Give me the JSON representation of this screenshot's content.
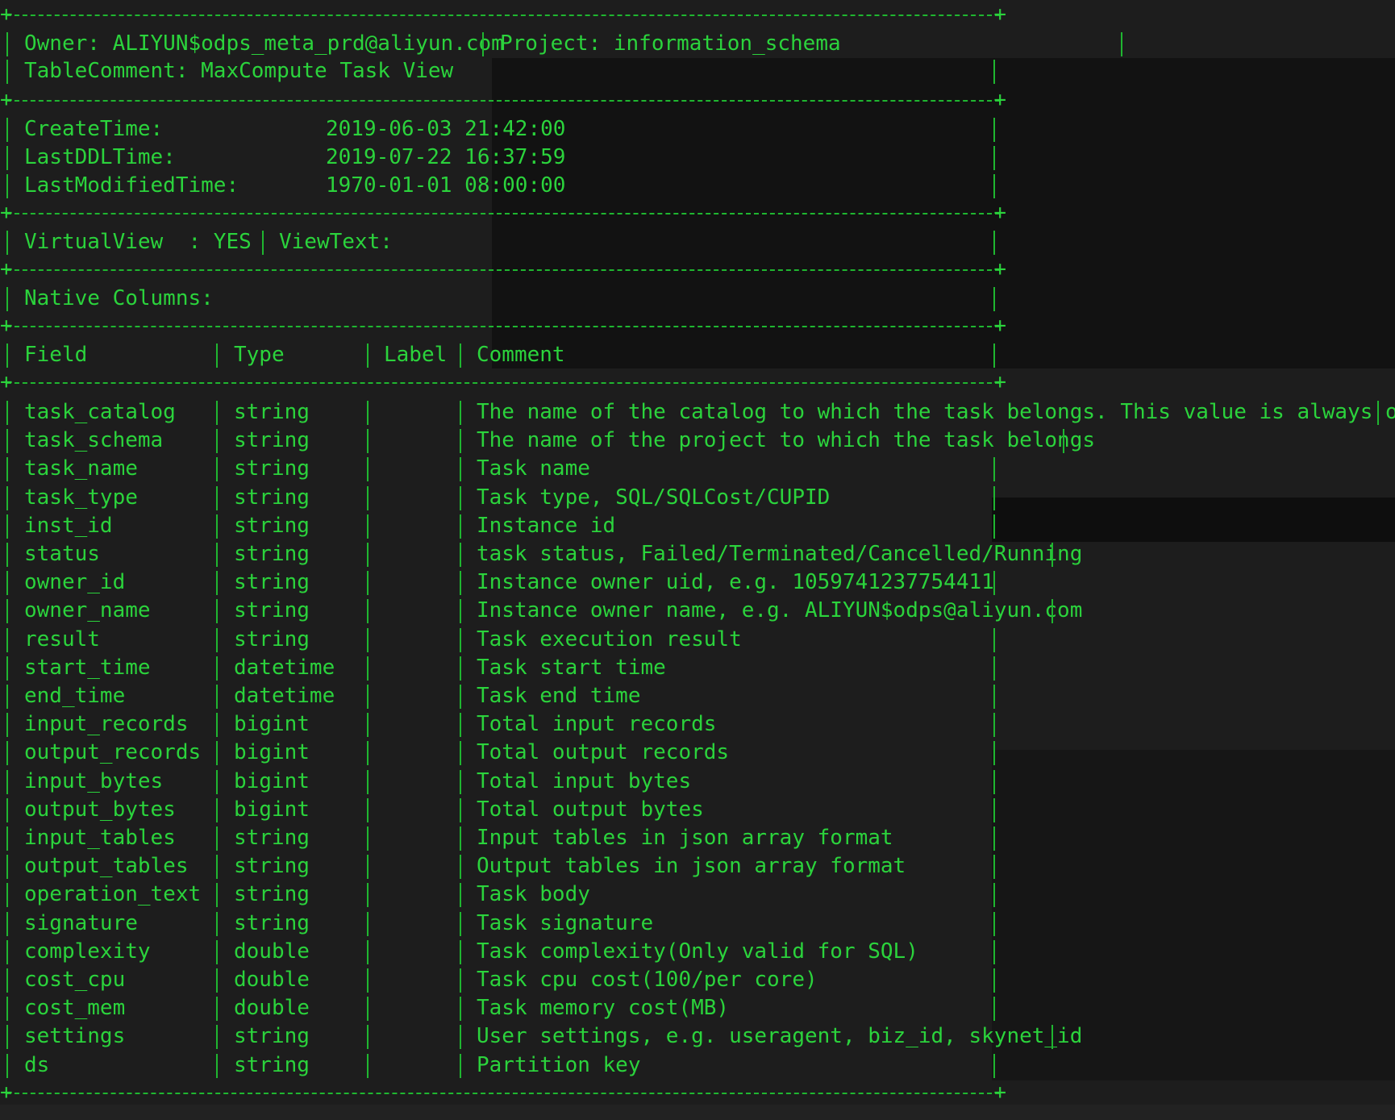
{
  "header": {
    "owner": "Owner: ALIYUN$odps_meta_prd@aliyun.com",
    "project": "Project: information_schema",
    "table_comment": "TableComment: MaxCompute Task View"
  },
  "times": [
    {
      "label": "CreateTime:",
      "value": "2019-06-03 21:42:00"
    },
    {
      "label": "LastDDLTime:",
      "value": "2019-07-22 16:37:59"
    },
    {
      "label": "LastModifiedTime:",
      "value": "1970-01-01 08:00:00"
    }
  ],
  "view": {
    "virtual_view": "VirtualView  : YES",
    "view_text": "ViewText:"
  },
  "native_columns_label": "Native Columns:",
  "columns_header": {
    "field": "Field",
    "type": "Type",
    "label": "Label",
    "comment": "Comment"
  },
  "rows": [
    {
      "field": "task_catalog",
      "type": "string",
      "label": "",
      "comment": "The name of the catalog to which the task belongs. This value is always odps"
    },
    {
      "field": "task_schema",
      "type": "string",
      "label": "",
      "comment": "The name of the project to which the task belongs"
    },
    {
      "field": "task_name",
      "type": "string",
      "label": "",
      "comment": "Task name"
    },
    {
      "field": "task_type",
      "type": "string",
      "label": "",
      "comment": "Task type, SQL/SQLCost/CUPID"
    },
    {
      "field": "inst_id",
      "type": "string",
      "label": "",
      "comment": "Instance id"
    },
    {
      "field": "status",
      "type": "string",
      "label": "",
      "comment": "task status, Failed/Terminated/Cancelled/Running"
    },
    {
      "field": "owner_id",
      "type": "string",
      "label": "",
      "comment": "Instance owner uid, e.g. 1059741237754411"
    },
    {
      "field": "owner_name",
      "type": "string",
      "label": "",
      "comment": "Instance owner name, e.g. ALIYUN$odps@aliyun.com"
    },
    {
      "field": "result",
      "type": "string",
      "label": "",
      "comment": "Task execution result"
    },
    {
      "field": "start_time",
      "type": "datetime",
      "label": "",
      "comment": "Task start time"
    },
    {
      "field": "end_time",
      "type": "datetime",
      "label": "",
      "comment": "Task end time"
    },
    {
      "field": "input_records",
      "type": "bigint",
      "label": "",
      "comment": "Total input records"
    },
    {
      "field": "output_records",
      "type": "bigint",
      "label": "",
      "comment": "Total output records"
    },
    {
      "field": "input_bytes",
      "type": "bigint",
      "label": "",
      "comment": "Total input bytes"
    },
    {
      "field": "output_bytes",
      "type": "bigint",
      "label": "",
      "comment": "Total output bytes"
    },
    {
      "field": "input_tables",
      "type": "string",
      "label": "",
      "comment": "Input tables in json array format"
    },
    {
      "field": "output_tables",
      "type": "string",
      "label": "",
      "comment": "Output tables in json array format"
    },
    {
      "field": "operation_text",
      "type": "string",
      "label": "",
      "comment": "Task body"
    },
    {
      "field": "signature",
      "type": "string",
      "label": "",
      "comment": "Task signature"
    },
    {
      "field": "complexity",
      "type": "double",
      "label": "",
      "comment": "Task complexity(Only valid for SQL)"
    },
    {
      "field": "cost_cpu",
      "type": "double",
      "label": "",
      "comment": "Task cpu cost(100/per core)"
    },
    {
      "field": "cost_mem",
      "type": "double",
      "label": "",
      "comment": "Task memory cost(MB)"
    },
    {
      "field": "settings",
      "type": "string",
      "label": "",
      "comment": "User settings, e.g. useragent, biz_id, skynet_id"
    },
    {
      "field": "ds",
      "type": "string",
      "label": "",
      "comment": "Partition key"
    }
  ],
  "colors": {
    "text": "#2bd33c",
    "rule": "#1fb630",
    "background": "#1d1d1d"
  }
}
